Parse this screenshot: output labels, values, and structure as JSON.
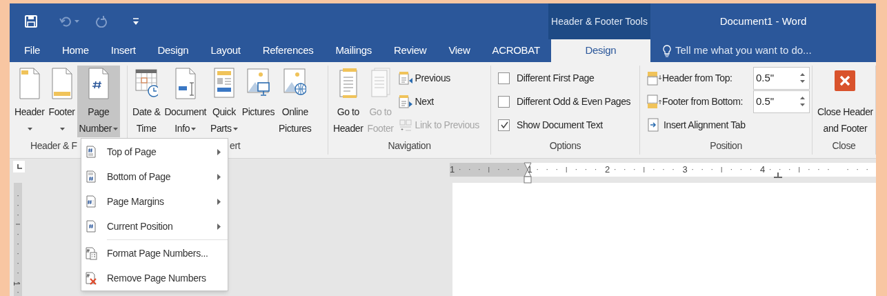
{
  "window": {
    "title": "Document1 - Word",
    "context_title": "Header & Footer Tools"
  },
  "tabs": [
    {
      "label": "File",
      "selected": false
    },
    {
      "label": "Home",
      "selected": false
    },
    {
      "label": "Insert",
      "selected": false
    },
    {
      "label": "Design",
      "selected": false
    },
    {
      "label": "Layout",
      "selected": false
    },
    {
      "label": "References",
      "selected": false
    },
    {
      "label": "Mailings",
      "selected": false
    },
    {
      "label": "Review",
      "selected": false
    },
    {
      "label": "View",
      "selected": false
    },
    {
      "label": "ACROBAT",
      "selected": false
    },
    {
      "label": "Design",
      "selected": true
    }
  ],
  "search": {
    "placeholder": "Tell me what you want to do..."
  },
  "ribbon": {
    "groups": [
      {
        "label": "Header & F",
        "controls": [
          {
            "kind": "large",
            "lines": [
              "Header"
            ],
            "dropdown": true,
            "selected": false,
            "disabled": false
          },
          {
            "kind": "large",
            "lines": [
              "Footer"
            ],
            "dropdown": true,
            "selected": false,
            "disabled": false
          },
          {
            "kind": "large",
            "lines": [
              "Page",
              "Number"
            ],
            "dropdown": true,
            "selected": true,
            "disabled": false
          }
        ]
      },
      {
        "label": "ert",
        "controls": [
          {
            "kind": "large",
            "lines": [
              "Date &",
              "Time"
            ],
            "dropdown": false,
            "selected": false,
            "disabled": false
          },
          {
            "kind": "large",
            "lines": [
              "Document",
              "Info"
            ],
            "dropdown": true,
            "selected": false,
            "disabled": false
          },
          {
            "kind": "large",
            "lines": [
              "Quick",
              "Parts"
            ],
            "dropdown": true,
            "selected": false,
            "disabled": false
          },
          {
            "kind": "large",
            "lines": [
              "Pictures"
            ],
            "dropdown": false,
            "selected": false,
            "disabled": false
          },
          {
            "kind": "large",
            "lines": [
              "Online",
              "Pictures"
            ],
            "dropdown": false,
            "selected": false,
            "disabled": false
          }
        ]
      },
      {
        "label": "Navigation",
        "controls": [
          {
            "kind": "large",
            "lines": [
              "Go to",
              "Header"
            ],
            "dropdown": false,
            "selected": false,
            "disabled": false
          },
          {
            "kind": "large",
            "lines": [
              "Go to",
              "Footer"
            ],
            "dropdown": false,
            "selected": false,
            "disabled": true
          },
          {
            "kind": "small",
            "label": "Previous",
            "disabled": false
          },
          {
            "kind": "small",
            "label": "Next",
            "disabled": false
          },
          {
            "kind": "small",
            "label": "Link to Previous",
            "disabled": true
          }
        ]
      },
      {
        "label": "Options",
        "controls": [
          {
            "kind": "checkbox",
            "label": "Different First Page",
            "checked": false
          },
          {
            "kind": "checkbox",
            "label": "Different Odd & Even Pages",
            "checked": false
          },
          {
            "kind": "checkbox",
            "label": "Show Document Text",
            "checked": true
          }
        ]
      },
      {
        "label": "Position",
        "controls": [
          {
            "kind": "spin",
            "label": "Header from Top:",
            "value": "0.5\""
          },
          {
            "kind": "spin",
            "label": "Footer from Bottom:",
            "value": "0.5\""
          },
          {
            "kind": "small",
            "label": "Insert Alignment Tab",
            "disabled": false
          }
        ]
      },
      {
        "label": "Close",
        "controls": [
          {
            "kind": "large",
            "lines": [
              "Close Header",
              "and Footer"
            ],
            "dropdown": false,
            "selected": false,
            "disabled": false
          }
        ]
      }
    ]
  },
  "ruler": {
    "labels": [
      "1",
      "1",
      "2",
      "3",
      "4"
    ]
  },
  "vertical_ruler": {
    "labels": [
      "1"
    ]
  },
  "menu": {
    "sections": [
      [
        {
          "label": "Top of Page",
          "submenu": true
        },
        {
          "label": "Bottom of Page",
          "submenu": true
        },
        {
          "label": "Page Margins",
          "submenu": true
        },
        {
          "label": "Current Position",
          "submenu": true
        }
      ],
      [
        {
          "label": "Format Page Numbers...",
          "submenu": false
        },
        {
          "label": "Remove Page Numbers",
          "submenu": false
        }
      ]
    ]
  }
}
